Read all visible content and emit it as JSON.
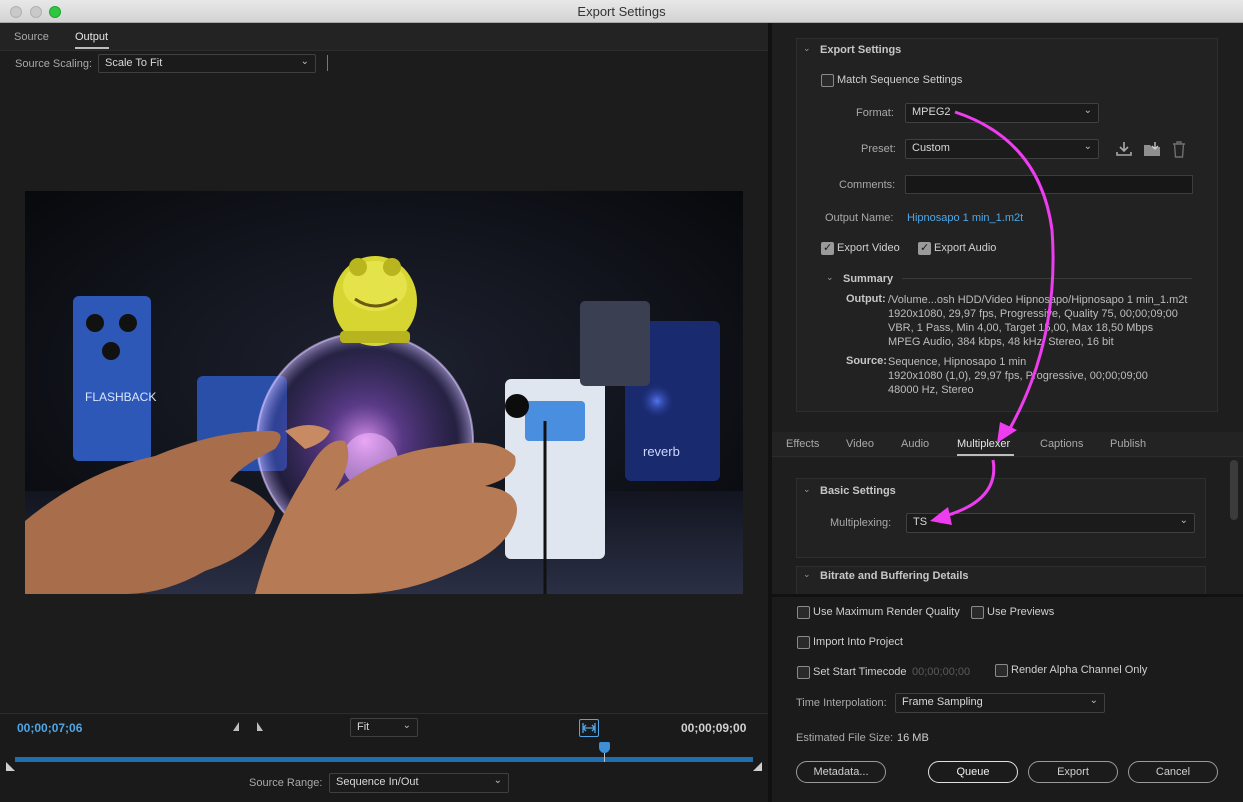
{
  "window": {
    "title": "Export Settings"
  },
  "left": {
    "tabs": [
      "Source",
      "Output"
    ],
    "active_tab": "Output",
    "source_scaling_label": "Source Scaling:",
    "source_scaling_value": "Scale To Fit",
    "timeline": {
      "current_time": "00;00;07;06",
      "end_time": "00;00;09;00",
      "zoom_value": "Fit",
      "source_range_label": "Source Range:",
      "source_range_value": "Sequence In/Out",
      "playhead_position": 0.8
    }
  },
  "export_settings": {
    "header": "Export Settings",
    "match_sequence_label": "Match Sequence Settings",
    "match_sequence_checked": false,
    "format_label": "Format:",
    "format_value": "MPEG2",
    "preset_label": "Preset:",
    "preset_value": "Custom",
    "comments_label": "Comments:",
    "comments_value": "",
    "output_name_label": "Output Name:",
    "output_name_value": "Hipnosapo 1 min_1.m2t",
    "export_video_label": "Export Video",
    "export_video_checked": true,
    "export_audio_label": "Export Audio",
    "export_audio_checked": true,
    "summary": {
      "header": "Summary",
      "output_label": "Output:",
      "output_lines": [
        "/Volume...osh HDD/Video Hipnosapo/Hipnosapo 1 min_1.m2t",
        "1920x1080, 29,97 fps, Progressive, Quality 75, 00;00;09;00",
        "VBR, 1 Pass, Min 4,00, Target 15,00, Max 18,50 Mbps",
        "MPEG Audio, 384 kbps, 48 kHz, Stereo, 16 bit"
      ],
      "source_label": "Source:",
      "source_lines": [
        "Sequence, Hipnosapo 1 min",
        "1920x1080 (1,0), 29,97 fps, Progressive, 00;00;09;00",
        "48000 Hz, Stereo"
      ]
    }
  },
  "settings_tabs": [
    "Effects",
    "Video",
    "Audio",
    "Multiplexer",
    "Captions",
    "Publish"
  ],
  "active_settings_tab": "Multiplexer",
  "basic_settings": {
    "header": "Basic Settings",
    "multiplexing_label": "Multiplexing:",
    "multiplexing_value": "TS"
  },
  "bitrate_header": "Bitrate and Buffering Details",
  "bottom": {
    "max_render_quality_label": "Use Maximum Render Quality",
    "use_previews_label": "Use Previews",
    "import_into_project_label": "Import Into Project",
    "set_start_timecode_label": "Set Start Timecode",
    "start_timecode_value": "00;00;00;00",
    "render_alpha_label": "Render Alpha Channel Only",
    "time_interpolation_label": "Time Interpolation:",
    "time_interpolation_value": "Frame Sampling",
    "estimated_size_label": "Estimated File Size:",
    "estimated_size_value": "16 MB",
    "buttons": {
      "metadata": "Metadata...",
      "queue": "Queue",
      "export": "Export",
      "cancel": "Cancel"
    }
  },
  "colors": {
    "accent_blue": "#4fa6e6",
    "annotation_magenta": "#ee3df0",
    "timeline_bar": "#1f6fb0"
  },
  "icons": [
    "chevron-down-icon",
    "save-preset-icon",
    "import-preset-icon",
    "trash-icon",
    "mark-in-icon",
    "mark-out-icon",
    "fit-range-icon",
    "playhead-icon",
    "disclosure-icon"
  ]
}
